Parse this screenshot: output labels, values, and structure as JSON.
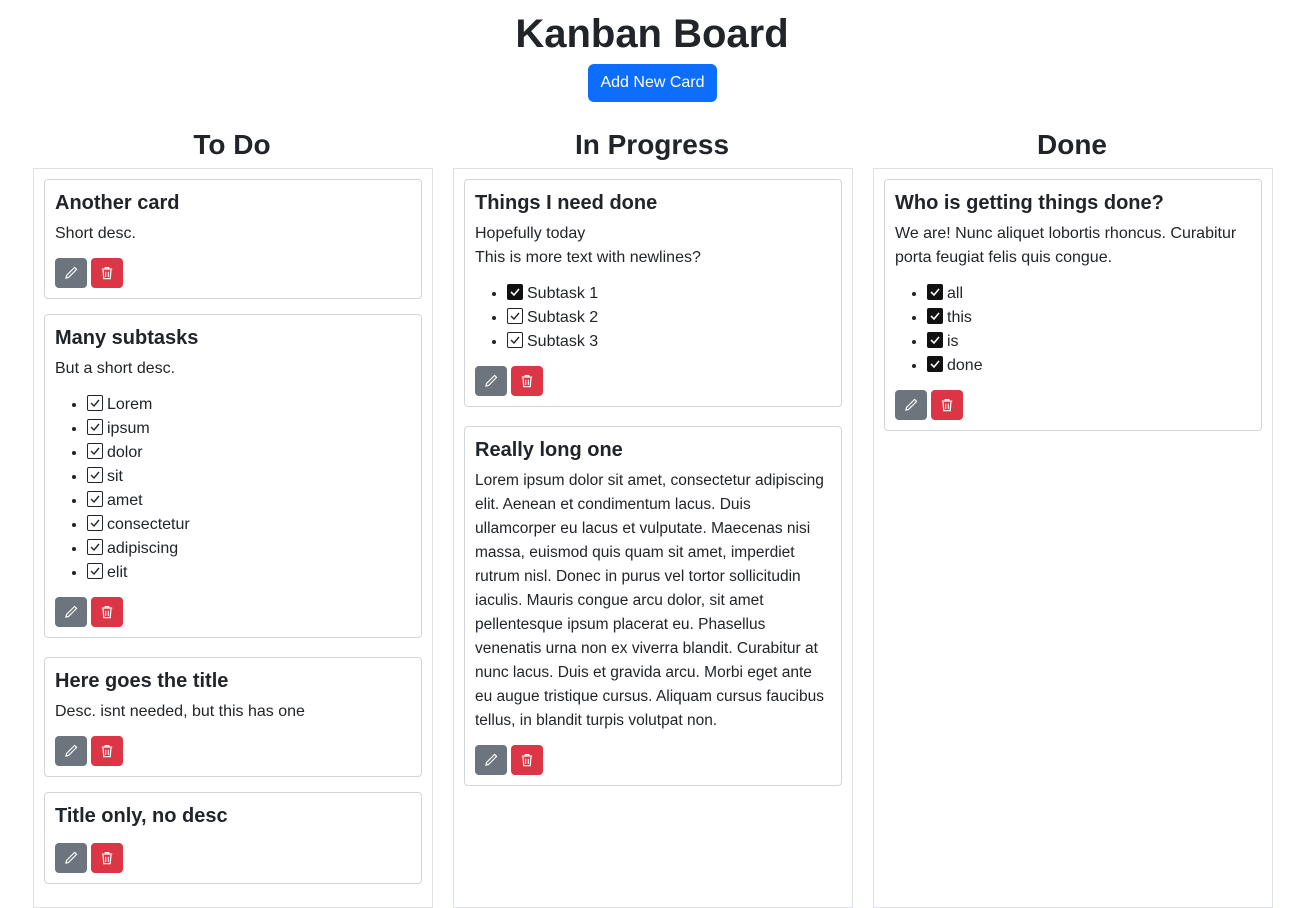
{
  "header": {
    "title": "Kanban Board",
    "add_button": "Add New Card"
  },
  "columns": [
    {
      "title": "To Do",
      "cards": [
        {
          "title": "Another card",
          "desc": "Short desc.",
          "subtasks": []
        },
        {
          "title": "Many subtasks",
          "desc": "But a short desc.",
          "subtasks": [
            {
              "label": "Lorem",
              "style": "outline"
            },
            {
              "label": "ipsum",
              "style": "outline"
            },
            {
              "label": "dolor",
              "style": "outline"
            },
            {
              "label": "sit",
              "style": "outline"
            },
            {
              "label": "amet",
              "style": "outline"
            },
            {
              "label": "consectetur",
              "style": "outline"
            },
            {
              "label": "adipiscing",
              "style": "outline"
            },
            {
              "label": "elit",
              "style": "outline"
            }
          ]
        },
        {
          "title": "Here goes the title",
          "desc": "Desc. isnt needed, but this has one",
          "subtasks": []
        },
        {
          "title": "Title only, no desc",
          "desc": "",
          "subtasks": []
        }
      ]
    },
    {
      "title": "In Progress",
      "cards": [
        {
          "title": "Things I need done",
          "desc": "Hopefully today\nThis is more text with newlines?",
          "subtasks": [
            {
              "label": "Subtask 1",
              "style": "filled"
            },
            {
              "label": "Subtask 2",
              "style": "outline"
            },
            {
              "label": "Subtask 3",
              "style": "outline"
            }
          ]
        },
        {
          "title": "Really long one",
          "desc": "Lorem ipsum dolor sit amet, consectetur adipiscing elit. Aenean et condimentum lacus. Duis ullamcorper eu lacus et vulputate. Maecenas nisi massa, euismod quis quam sit amet, imperdiet rutrum nisl. Donec in purus vel tortor sollicitudin iaculis. Mauris congue arcu dolor, sit amet pellentesque ipsum placerat eu. Phasellus venenatis urna non ex viverra blandit. Curabitur at nunc lacus. Duis et gravida arcu. Morbi eget ante eu augue tristique cursus. Aliquam cursus faucibus tellus, in blandit turpis volutpat non.",
          "subtasks": []
        }
      ]
    },
    {
      "title": "Done",
      "cards": [
        {
          "title": "Who is getting things done?",
          "desc": "We are! Nunc aliquet lobortis rhoncus. Curabitur porta feugiat felis quis congue.",
          "subtasks": [
            {
              "label": "all",
              "style": "filled"
            },
            {
              "label": "this",
              "style": "filled"
            },
            {
              "label": "is",
              "style": "filled"
            },
            {
              "label": "done",
              "style": "filled"
            }
          ]
        }
      ]
    }
  ],
  "icons": {
    "edit": "pencil-icon",
    "delete": "trash-icon"
  },
  "colors": {
    "primary": "#0d6efd",
    "edit": "#6c757d",
    "delete": "#dc3545",
    "border": "#dee2e6"
  }
}
